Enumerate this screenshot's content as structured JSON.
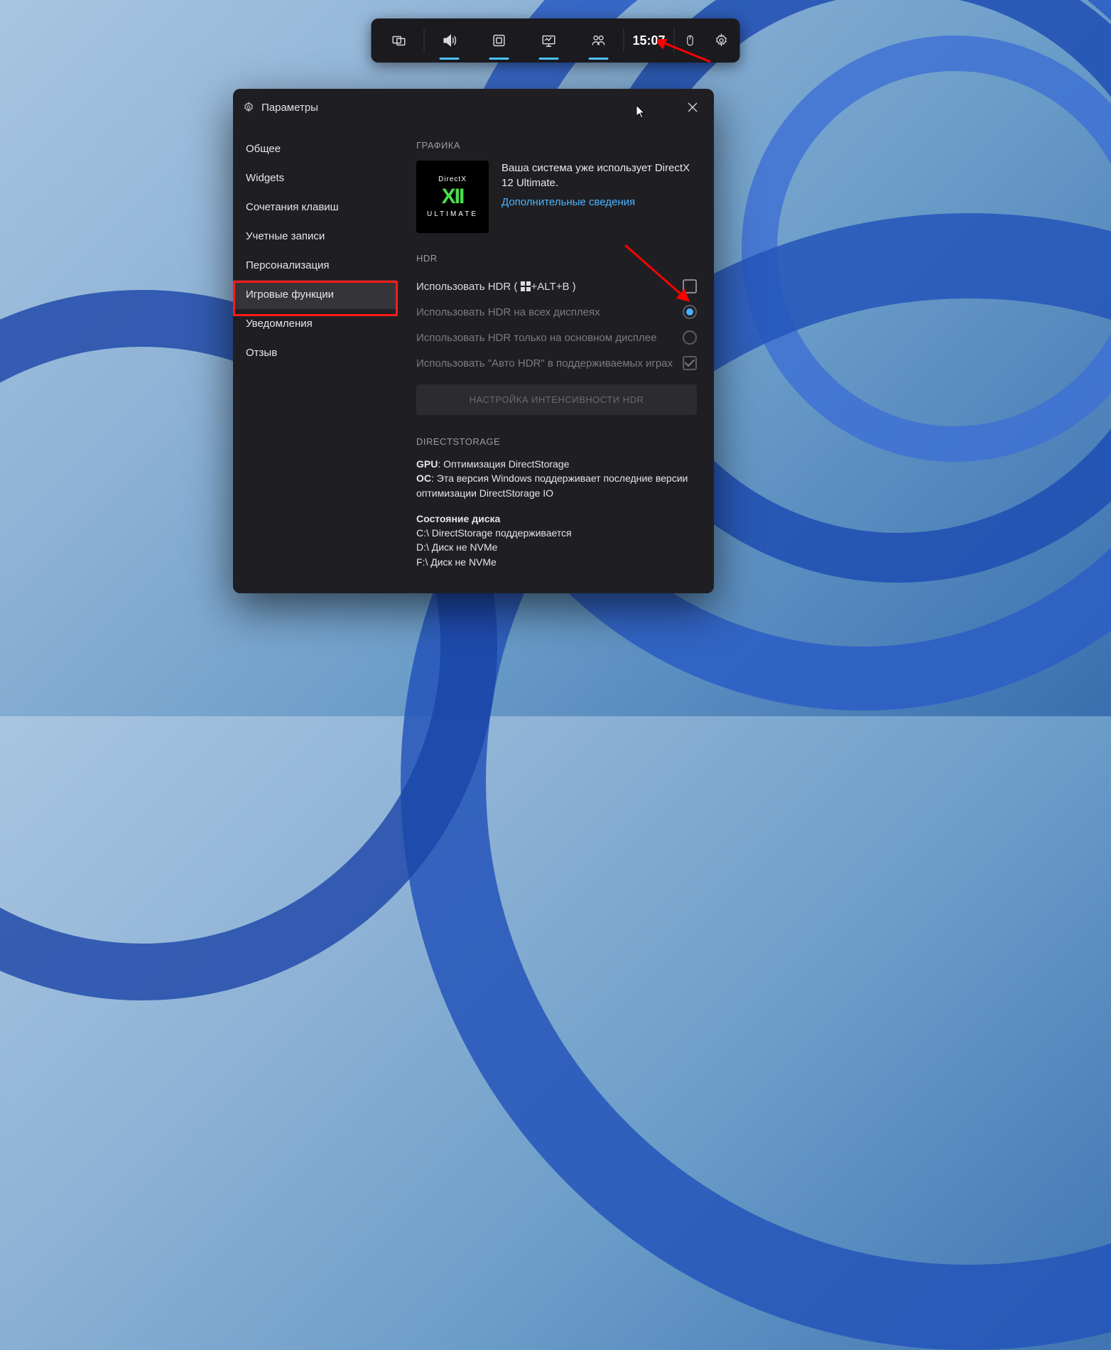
{
  "gamebar": {
    "time": "15:07"
  },
  "panel": {
    "title": "Параметры",
    "sidebar": {
      "items": [
        "Общее",
        "Widgets",
        "Сочетания клавиш",
        "Учетные записи",
        "Персонализация",
        "Игровые функции",
        "Уведомления",
        "Отзыв"
      ],
      "active_index": 5
    },
    "graphics": {
      "heading": "ГРАФИКА",
      "dx_top": "DirectX",
      "dx_mid": "XII",
      "dx_bot": "ULTIMATE",
      "message": "Ваша система уже использует DirectX 12 Ultimate.",
      "link": "Дополнительные сведения"
    },
    "hdr": {
      "heading": "HDR",
      "use_hdr_prefix": "Использовать HDR ( ",
      "use_hdr_suffix": "+ALT+B )",
      "all_displays": "Использовать HDR на всех дисплеях",
      "main_display": "Использовать HDR только на основном дисплее",
      "auto_hdr": "Использовать \"Авто HDR\" в поддерживаемых играх",
      "button": "НАСТРОЙКА ИНТЕНСИВНОСТИ HDR"
    },
    "directstorage": {
      "heading": "DIRECTSTORAGE",
      "gpu_label": "GPU",
      "gpu_text": ": Оптимизация DirectStorage",
      "os_label": "ОС",
      "os_text": ": Эта версия Windows поддерживает последние версии оптимизации DirectStorage IO",
      "disk_state": "Состояние диска",
      "disk_c": "C:\\ DirectStorage поддерживается",
      "disk_d": "D:\\ Диск не NVMe",
      "disk_f": "F:\\ Диск не NVMe"
    }
  }
}
